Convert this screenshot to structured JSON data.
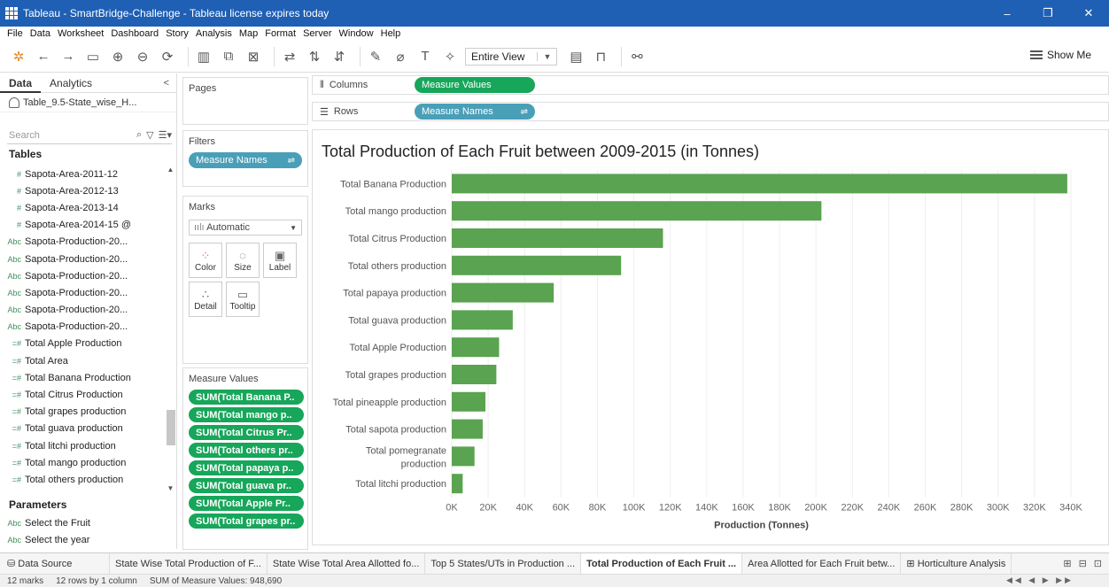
{
  "titlebar": {
    "title": "Tableau - SmartBridge-Challenge - Tableau license expires today",
    "buttons": [
      "–",
      "❐",
      "✕"
    ]
  },
  "menu": [
    "File",
    "Data",
    "Worksheet",
    "Dashboard",
    "Story",
    "Analysis",
    "Map",
    "Format",
    "Server",
    "Window",
    "Help"
  ],
  "toolbar": {
    "view_select": "Entire View",
    "show_me": "Show Me"
  },
  "datapane": {
    "tab_data": "Data",
    "tab_analytics": "Analytics",
    "datasource": "Table_9.5-State_wise_H...",
    "search_placeholder": "Search",
    "tables_header": "Tables",
    "fields": [
      {
        "type": "#",
        "name": "Sapota-Area-2011-12"
      },
      {
        "type": "#",
        "name": "Sapota-Area-2012-13"
      },
      {
        "type": "#",
        "name": "Sapota-Area-2013-14"
      },
      {
        "type": "#",
        "name": "Sapota-Area-2014-15 @"
      },
      {
        "type": "Abc",
        "name": "Sapota-Production-20..."
      },
      {
        "type": "Abc",
        "name": "Sapota-Production-20..."
      },
      {
        "type": "Abc",
        "name": "Sapota-Production-20..."
      },
      {
        "type": "Abc",
        "name": "Sapota-Production-20..."
      },
      {
        "type": "Abc",
        "name": "Sapota-Production-20..."
      },
      {
        "type": "Abc",
        "name": "Sapota-Production-20..."
      },
      {
        "type": "=#",
        "name": "Total Apple Production"
      },
      {
        "type": "=#",
        "name": "Total Area"
      },
      {
        "type": "=#",
        "name": "Total Banana Production"
      },
      {
        "type": "=#",
        "name": "Total Citrus Production"
      },
      {
        "type": "=#",
        "name": "Total grapes production"
      },
      {
        "type": "=#",
        "name": "Total guava production"
      },
      {
        "type": "=#",
        "name": "Total litchi production"
      },
      {
        "type": "=#",
        "name": "Total mango production"
      },
      {
        "type": "=#",
        "name": "Total others production"
      }
    ],
    "parameters_header": "Parameters",
    "parameters": [
      {
        "type": "Abc",
        "name": "Select the Fruit"
      },
      {
        "type": "Abc",
        "name": "Select the year"
      }
    ]
  },
  "shelves": {
    "pages": "Pages",
    "filters": "Filters",
    "filter_pill": "Measure Names",
    "marks": "Marks",
    "marks_type": "Automatic",
    "mark_buttons": [
      "Color",
      "Size",
      "Label",
      "Detail",
      "Tooltip"
    ],
    "measure_values": "Measure Values",
    "measure_pills": [
      "SUM(Total Banana P..",
      "SUM(Total mango p..",
      "SUM(Total Citrus Pr..",
      "SUM(Total others pr..",
      "SUM(Total papaya p..",
      "SUM(Total guava pr..",
      "SUM(Total Apple Pr..",
      "SUM(Total grapes pr.."
    ],
    "columns_label": "Columns",
    "columns_pill": "Measure Values",
    "rows_label": "Rows",
    "rows_pill": "Measure Names"
  },
  "chart_data": {
    "type": "bar",
    "orientation": "horizontal",
    "title": "Total Production of Each Fruit between 2009-2015 (in Tonnes)",
    "xlabel": "Production (Tonnes)",
    "ylabel": "",
    "xlim": [
      0,
      340000
    ],
    "xticks": [
      0,
      20000,
      40000,
      60000,
      80000,
      100000,
      120000,
      140000,
      160000,
      180000,
      200000,
      220000,
      240000,
      260000,
      280000,
      300000,
      320000,
      340000
    ],
    "xtick_labels": [
      "0K",
      "20K",
      "40K",
      "60K",
      "80K",
      "100K",
      "120K",
      "140K",
      "160K",
      "180K",
      "200K",
      "220K",
      "240K",
      "260K",
      "280K",
      "300K",
      "320K",
      "340K"
    ],
    "grid": true,
    "color": "#5aa350",
    "categories": [
      "Total Banana Production",
      "Total mango production",
      "Total Citrus Production",
      "Total others production",
      "Total papaya production",
      "Total guava production",
      "Total Apple Production",
      "Total grapes production",
      "Total pineapple production",
      "Total sapota production",
      "Total pomegranate production",
      "Total litchi production"
    ],
    "values": [
      338000,
      203000,
      116000,
      93000,
      56000,
      33500,
      26000,
      24500,
      18500,
      17000,
      12500,
      6000
    ]
  },
  "sheet_tabs": {
    "data_source": "Data Source",
    "tabs": [
      "State Wise Total Production of F...",
      "State Wise Total Area Allotted fo...",
      "Top 5 States/UTs in Production ...",
      "Total Production of Each Fruit ...",
      "Area Allotted for Each Fruit betw...",
      "Horticulture Analysis"
    ],
    "active_index": 3
  },
  "status": {
    "marks": "12 marks",
    "dims": "12 rows by 1 column",
    "sum": "SUM of Measure Values: 948,690"
  },
  "colors": {
    "titlebar": "#1f5fb4",
    "pill_blue": "#4a9fb8",
    "pill_green": "#17a65a",
    "bar": "#5aa350"
  }
}
